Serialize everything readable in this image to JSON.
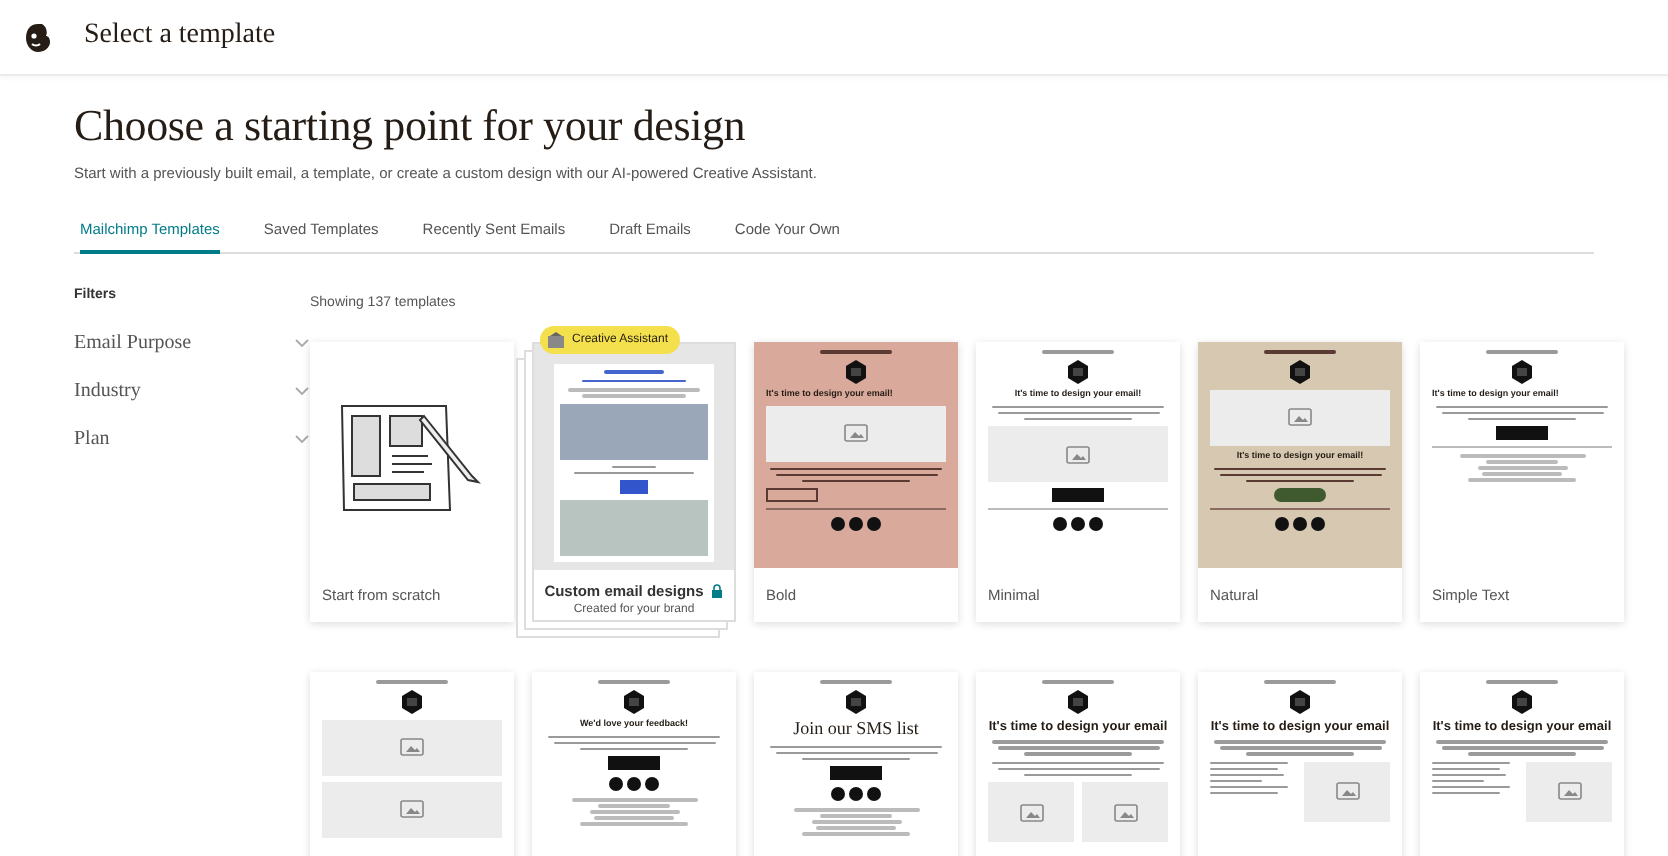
{
  "header": {
    "title": "Select a template"
  },
  "heading": "Choose a starting point for your design",
  "subtitle": "Start with a previously built email, a template, or create a custom design with our AI-powered Creative Assistant.",
  "tabs": [
    {
      "label": "Mailchimp Templates",
      "selected": true
    },
    {
      "label": "Saved Templates",
      "selected": false
    },
    {
      "label": "Recently Sent Emails",
      "selected": false
    },
    {
      "label": "Draft Emails",
      "selected": false
    },
    {
      "label": "Code Your Own",
      "selected": false
    }
  ],
  "filters": {
    "title": "Filters",
    "items": [
      {
        "label": "Email Purpose"
      },
      {
        "label": "Industry"
      },
      {
        "label": "Plan"
      }
    ]
  },
  "count": "Showing 137 templates",
  "templates": [
    {
      "kind": "scratch",
      "name": "Start from scratch"
    },
    {
      "kind": "custom",
      "badge": "Creative Assistant",
      "name": "Custom email designs",
      "caption": "Created for your brand"
    },
    {
      "kind": "email",
      "name": "Bold",
      "color": "#d9a99b",
      "blocks": [
        {
          "kind": "link"
        },
        {
          "kind": "logo"
        },
        {
          "kind": "headline-left",
          "text": "It's time to design your email!"
        },
        {
          "kind": "photo"
        },
        {
          "kind": "text"
        },
        {
          "kind": "button-outline"
        },
        {
          "kind": "divider"
        },
        {
          "kind": "social"
        }
      ]
    },
    {
      "kind": "email",
      "name": "Minimal",
      "color": "#ffffff",
      "blocks": [
        {
          "kind": "link"
        },
        {
          "kind": "logo"
        },
        {
          "kind": "headline",
          "text": "It's time to design your email!"
        },
        {
          "kind": "text"
        },
        {
          "kind": "photo"
        },
        {
          "kind": "button"
        },
        {
          "kind": "divider"
        },
        {
          "kind": "social"
        }
      ]
    },
    {
      "kind": "email",
      "name": "Natural",
      "color": "#d7c8b1",
      "blocks": [
        {
          "kind": "link"
        },
        {
          "kind": "logo"
        },
        {
          "kind": "photo"
        },
        {
          "kind": "headline",
          "text": "It's time to design your email!"
        },
        {
          "kind": "text"
        },
        {
          "kind": "button-green"
        },
        {
          "kind": "divider"
        },
        {
          "kind": "social"
        }
      ]
    },
    {
      "kind": "email",
      "name": "Simple Text",
      "color": "#ffffff",
      "blocks": [
        {
          "kind": "link"
        },
        {
          "kind": "logo"
        },
        {
          "kind": "headline-left",
          "text": "It's time to design your email!"
        },
        {
          "kind": "text"
        },
        {
          "kind": "button"
        },
        {
          "kind": "divider"
        },
        {
          "kind": "footer"
        }
      ]
    },
    {
      "kind": "email",
      "color": "#ffffff",
      "blocks": [
        {
          "kind": "link"
        },
        {
          "kind": "logo"
        },
        {
          "kind": "photo"
        },
        {
          "kind": "photo"
        }
      ]
    },
    {
      "kind": "email",
      "color": "#ffffff",
      "blocks": [
        {
          "kind": "link"
        },
        {
          "kind": "logo"
        },
        {
          "kind": "headline",
          "text": "We'd love your feedback!"
        },
        {
          "kind": "text"
        },
        {
          "kind": "button"
        },
        {
          "kind": "social"
        },
        {
          "kind": "footer"
        }
      ]
    },
    {
      "kind": "email",
      "color": "#ffffff",
      "blocks": [
        {
          "kind": "link"
        },
        {
          "kind": "logo"
        },
        {
          "kind": "serif-heading",
          "text": "Join our SMS list"
        },
        {
          "kind": "text"
        },
        {
          "kind": "button"
        },
        {
          "kind": "social"
        },
        {
          "kind": "footer"
        }
      ]
    },
    {
      "kind": "email",
      "color": "#ffffff",
      "blocks": [
        {
          "kind": "link"
        },
        {
          "kind": "logo"
        },
        {
          "kind": "heading",
          "text": "It's time to design your email"
        },
        {
          "kind": "text"
        },
        {
          "kind": "text"
        },
        {
          "kind": "photo-pair"
        }
      ]
    },
    {
      "kind": "email",
      "color": "#ffffff",
      "blocks": [
        {
          "kind": "link"
        },
        {
          "kind": "logo"
        },
        {
          "kind": "heading",
          "text": "It's time to design your email"
        },
        {
          "kind": "text"
        },
        {
          "kind": "split"
        }
      ]
    },
    {
      "kind": "email",
      "color": "#ffffff",
      "blocks": [
        {
          "kind": "link"
        },
        {
          "kind": "logo"
        },
        {
          "kind": "heading",
          "text": "It's time to design your email"
        },
        {
          "kind": "text"
        },
        {
          "kind": "split"
        }
      ]
    }
  ]
}
